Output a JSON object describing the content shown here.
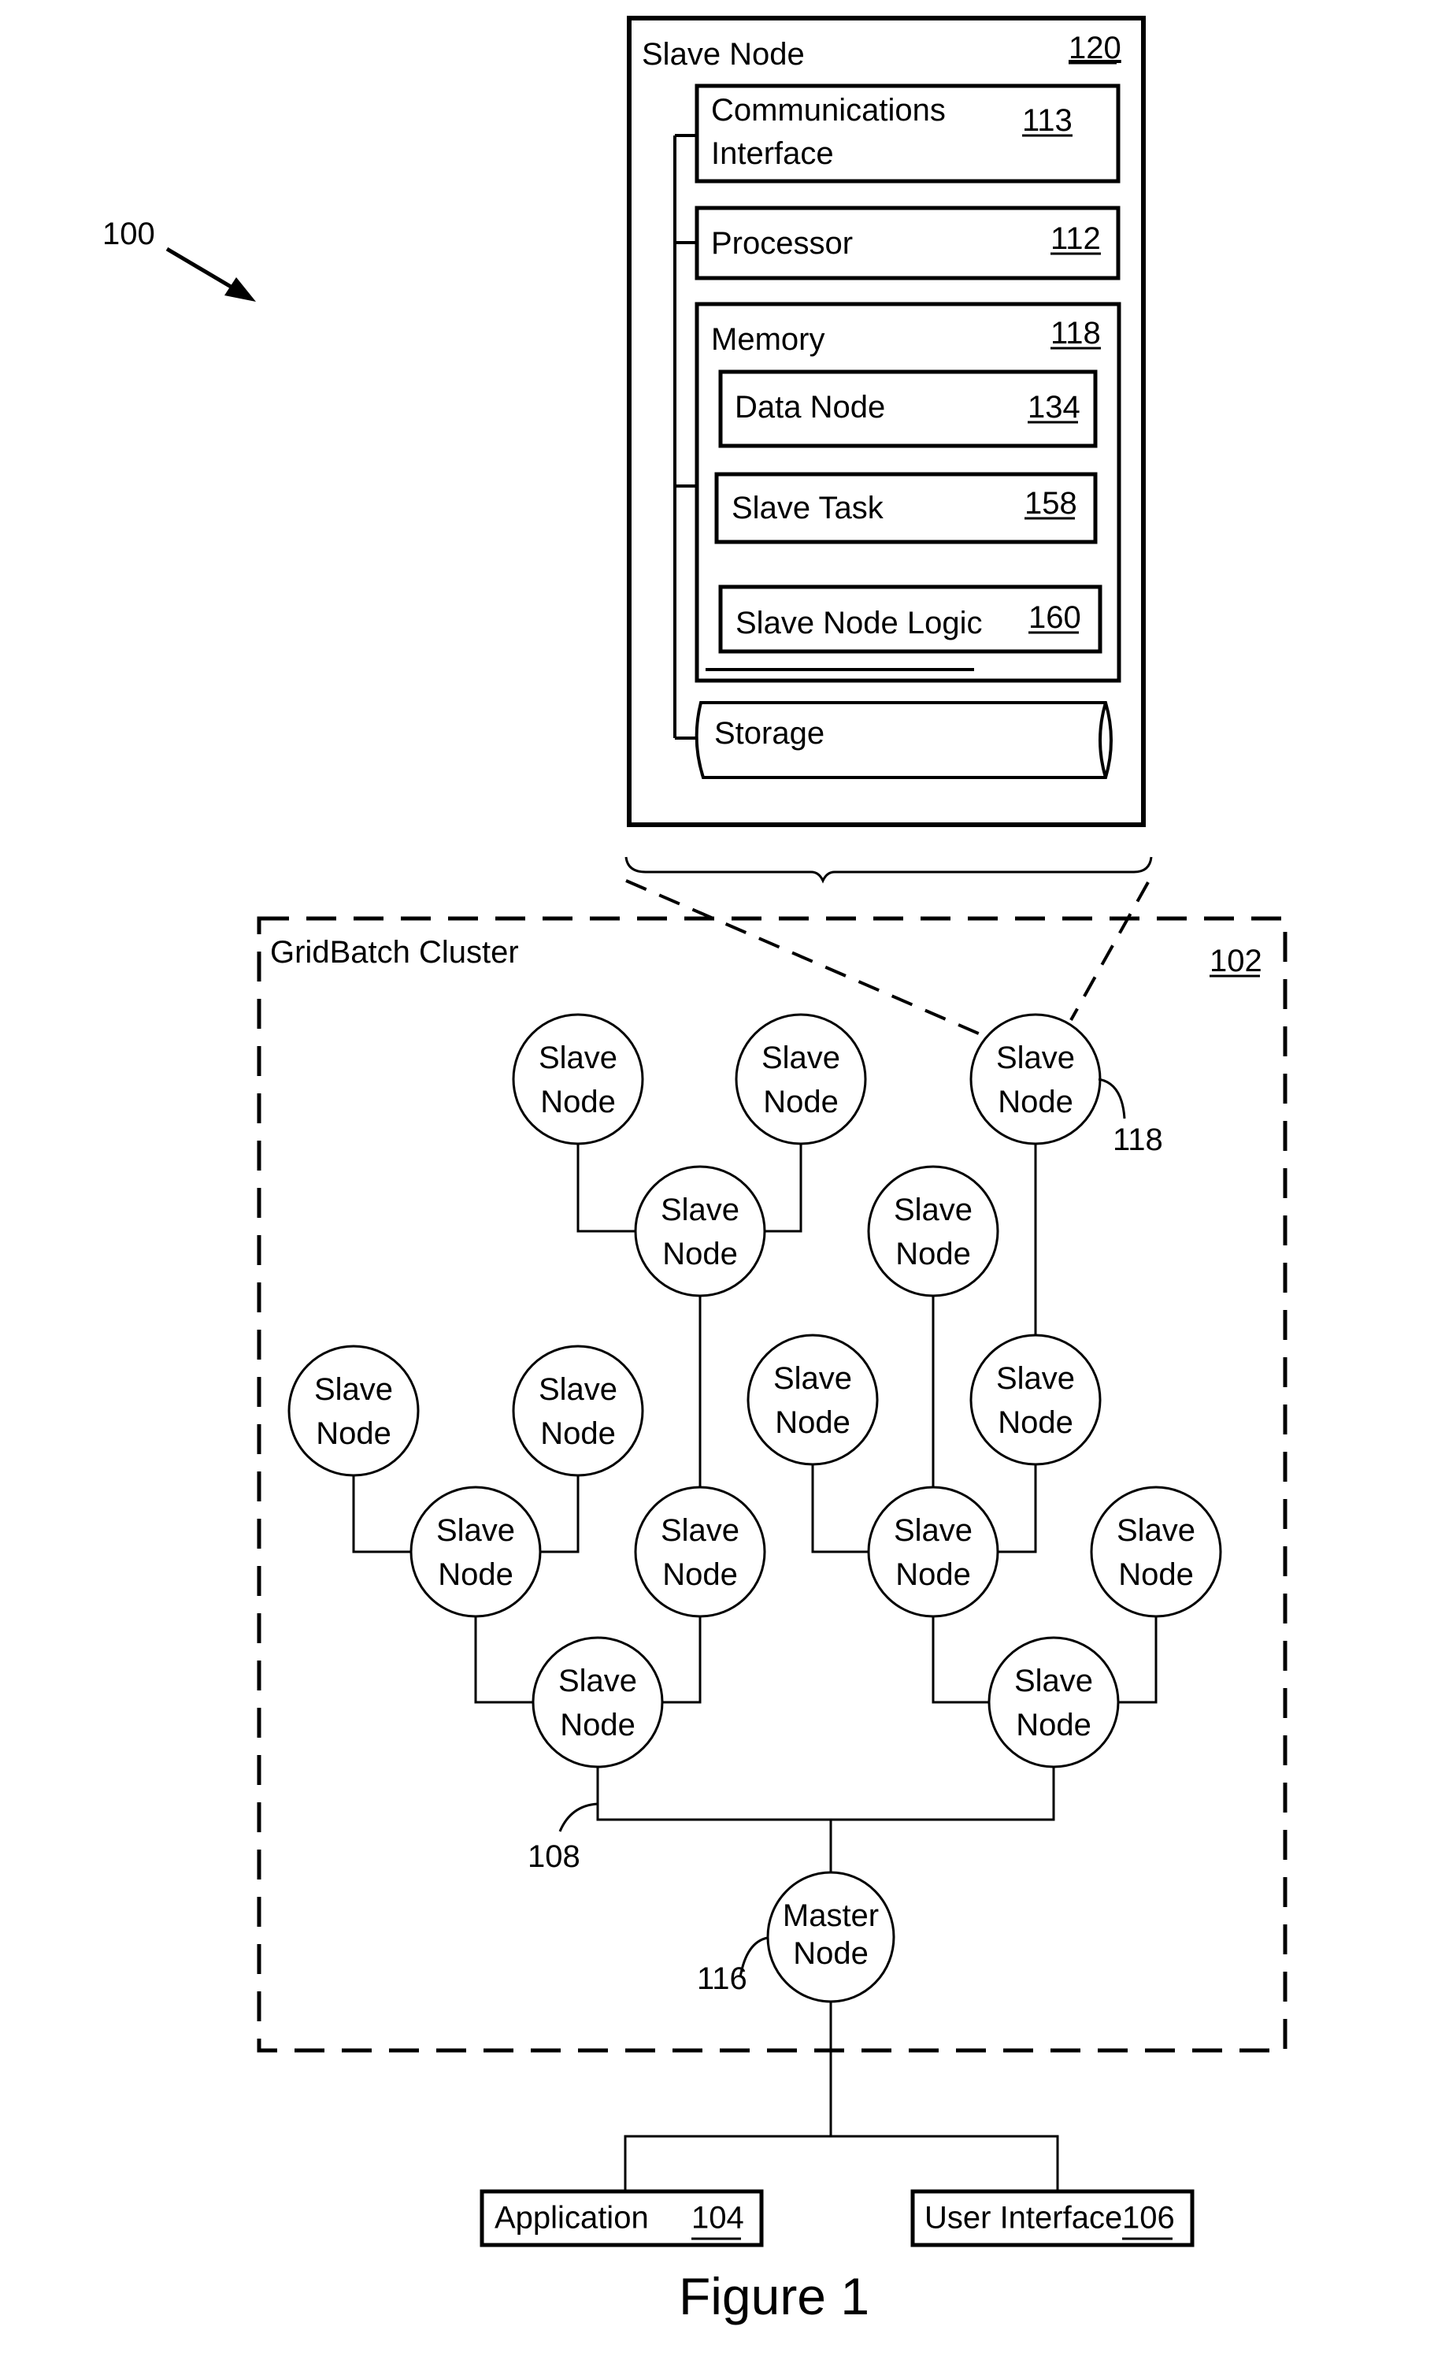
{
  "figure": {
    "ref_label": "100",
    "caption": "Figure 1"
  },
  "slave_node_detail": {
    "title": "Slave Node",
    "ref": "120",
    "components": {
      "comm_interface": {
        "line1": "Communications",
        "line2": "Interface",
        "ref": "113"
      },
      "processor": {
        "label": "Processor",
        "ref": "112"
      },
      "memory": {
        "label": "Memory",
        "ref": "118"
      },
      "data_node": {
        "label": "Data Node",
        "ref": "134"
      },
      "slave_task": {
        "label": "Slave Task",
        "ref": "158"
      },
      "slave_node_logic": {
        "label": "Slave Node Logic",
        "ref": "160"
      },
      "storage": {
        "label": "Storage"
      }
    }
  },
  "cluster": {
    "title": "GridBatch Cluster",
    "ref": "102",
    "slave_node_line1": "Slave",
    "slave_node_line2": "Node",
    "highlighted_slave_ref": "118",
    "bus_ref": "108",
    "master": {
      "line1": "Master",
      "line2": "Node",
      "ref": "116"
    }
  },
  "externals": {
    "application": {
      "label": "Application",
      "ref": "104"
    },
    "user_interface": {
      "label": "User Interface",
      "ref": "106"
    }
  }
}
